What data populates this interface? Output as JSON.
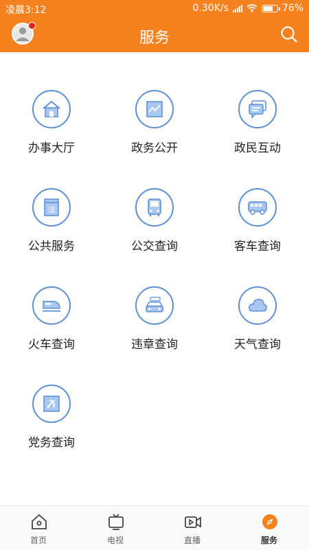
{
  "status_bar": {
    "time": "凌晨3:12",
    "net_speed": "0.30K/s",
    "battery": "76%",
    "battery_level": 0.76
  },
  "header": {
    "title": "服务",
    "avatar_icon": "user-avatar",
    "search_icon": "search-icon"
  },
  "colors": {
    "brand": "#f5821f",
    "icon_blue": "#5b8fd6",
    "badge": "#e0201b"
  },
  "services": [
    {
      "label": "办事大厅",
      "icon": "house-icon"
    },
    {
      "label": "政务公开",
      "icon": "chart-icon"
    },
    {
      "label": "政民互动",
      "icon": "chat-icon"
    },
    {
      "label": "公共服务",
      "icon": "law-book-icon"
    },
    {
      "label": "公交查询",
      "icon": "bus-icon"
    },
    {
      "label": "客车查询",
      "icon": "coach-icon"
    },
    {
      "label": "火车查询",
      "icon": "train-icon"
    },
    {
      "label": "违章查询",
      "icon": "car-icon"
    },
    {
      "label": "天气查询",
      "icon": "cloud-icon"
    },
    {
      "label": "党务查询",
      "icon": "party-flag-icon"
    }
  ],
  "tabs": [
    {
      "label": "首页",
      "icon": "home-icon"
    },
    {
      "label": "电视",
      "icon": "tv-icon"
    },
    {
      "label": "直播",
      "icon": "live-video-icon"
    },
    {
      "label": "服务",
      "icon": "compass-icon",
      "active": true
    }
  ]
}
